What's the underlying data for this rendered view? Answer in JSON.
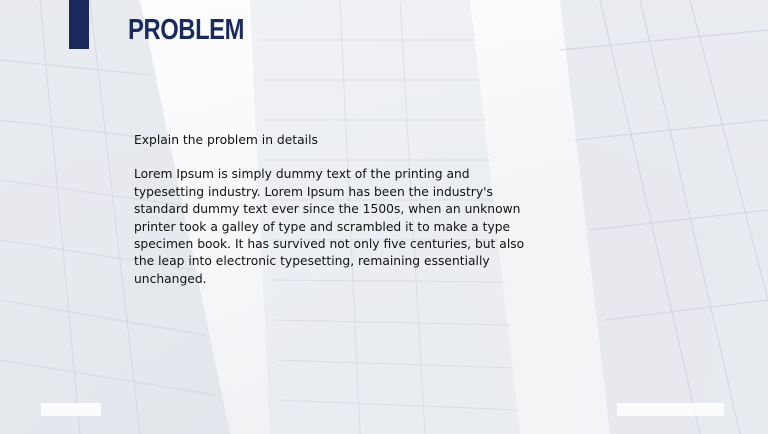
{
  "slide": {
    "title": "PROBLEM",
    "subtitle": "Explain the problem in details",
    "body": "Lorem Ipsum is simply dummy text of the printing and typesetting industry. Lorem Ipsum has been the industry's standard dummy text ever since the 1500s, when an unknown printer took a galley of type and scrambled it to make a type specimen book. It has survived not only five centuries, but also the leap into electronic typesetting, remaining essentially unchanged."
  },
  "colors": {
    "accent": "#1a2a5c",
    "text": "#111111",
    "background": "#eef1f6"
  }
}
